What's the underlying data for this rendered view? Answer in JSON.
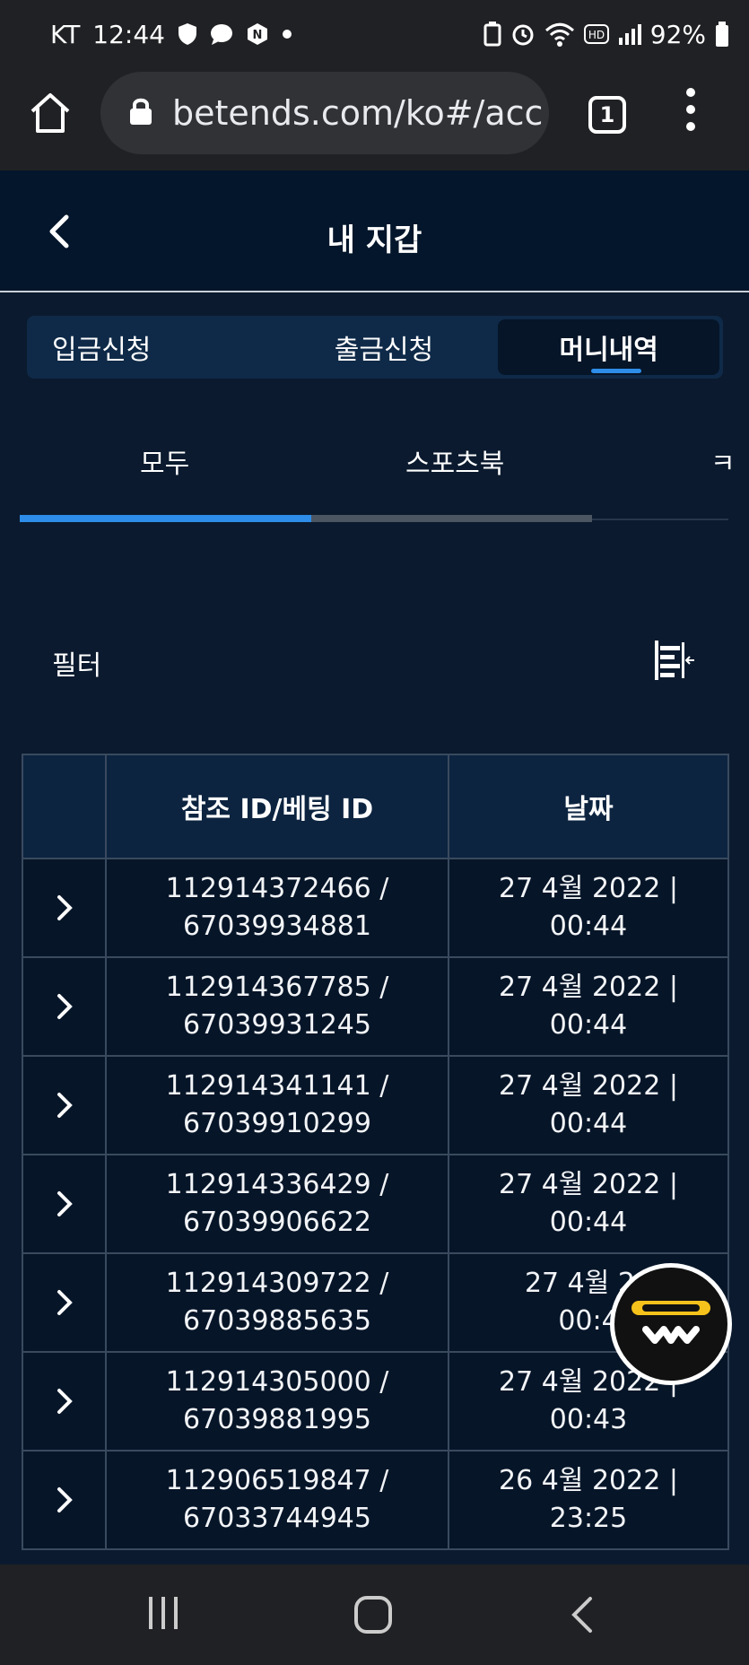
{
  "status": {
    "carrier": "KT",
    "time": "12:44",
    "battery": "92%"
  },
  "browser": {
    "url": "betends.com/ko#/acc",
    "tab_count": "1"
  },
  "header": {
    "title": "내 지갑"
  },
  "tabs": [
    {
      "label": "입금신청",
      "active": false
    },
    {
      "label": "출금신청",
      "active": false
    },
    {
      "label": "머니내역",
      "active": true
    }
  ],
  "sub_tabs": [
    {
      "label": "모두"
    },
    {
      "label": "스포츠북"
    },
    {
      "label": "ㅋ"
    }
  ],
  "sub_tab_progress": 0.51,
  "filter": {
    "label": "필터"
  },
  "table": {
    "headers": [
      "",
      "참조 ID/베팅 ID",
      "날짜"
    ],
    "rows": [
      {
        "ref_id": "112914372466 /",
        "bet_id": "67039934881",
        "date": "27 4월 2022 |",
        "time": "00:44"
      },
      {
        "ref_id": "112914367785 /",
        "bet_id": "67039931245",
        "date": "27 4월 2022 |",
        "time": "00:44"
      },
      {
        "ref_id": "112914341141 /",
        "bet_id": "67039910299",
        "date": "27 4월 2022 |",
        "time": "00:44"
      },
      {
        "ref_id": "112914336429 /",
        "bet_id": "67039906622",
        "date": "27 4월 2022 |",
        "time": "00:44"
      },
      {
        "ref_id": "112914309722 /",
        "bet_id": "67039885635",
        "date": "27 4월 20",
        "time": "00:4"
      },
      {
        "ref_id": "112914305000 /",
        "bet_id": "67039881995",
        "date": "27 4월 2022 |",
        "time": "00:43"
      },
      {
        "ref_id": "112906519847 /",
        "bet_id": "67033744945",
        "date": "26 4월 2022 |",
        "time": "23:25"
      }
    ]
  },
  "colors": {
    "background": "#0b1a2e",
    "accent": "#2d8de8",
    "fab_yellow": "#f5c21b"
  }
}
